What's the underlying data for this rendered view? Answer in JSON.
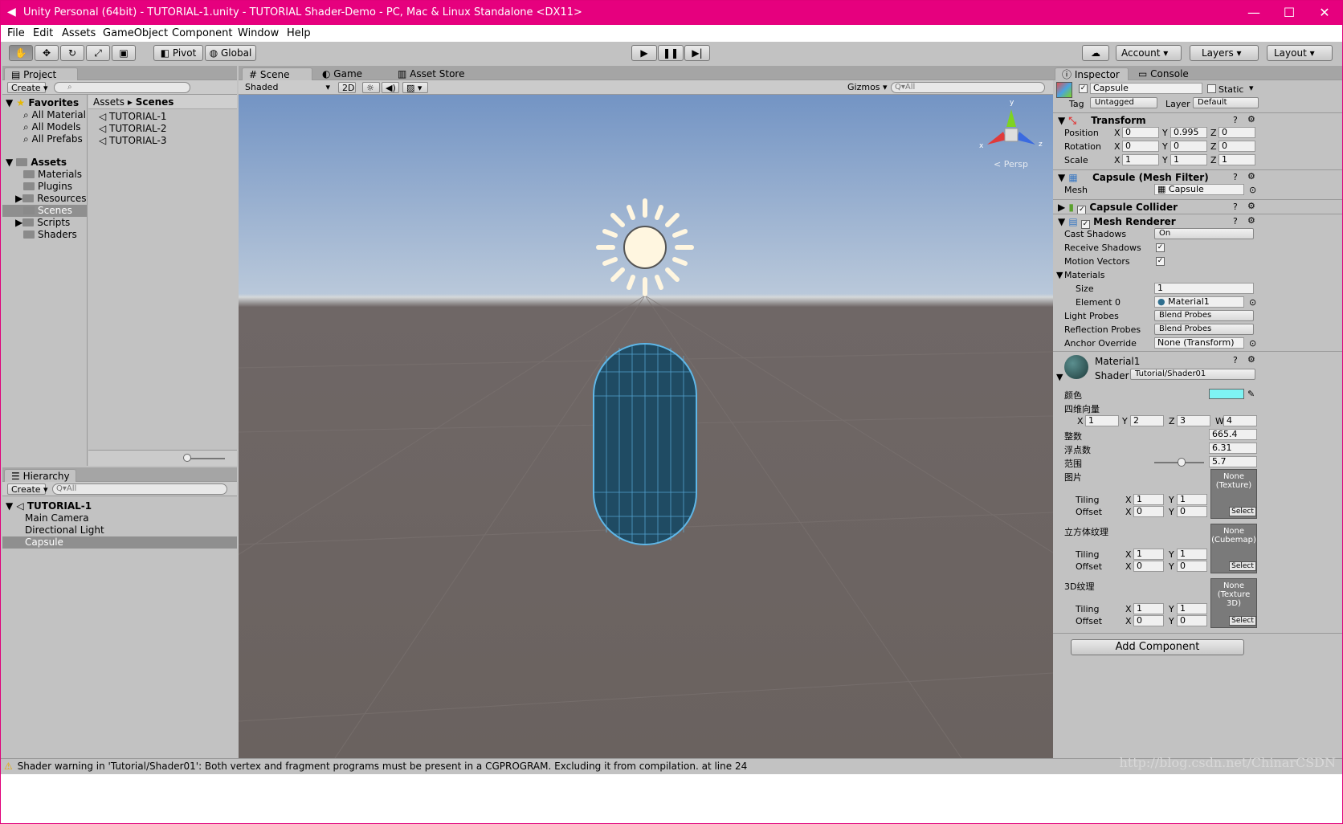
{
  "window": {
    "title": "Unity Personal (64bit) - TUTORIAL-1.unity - TUTORIAL  Shader-Demo - PC, Mac & Linux Standalone <DX11>",
    "controls": [
      "—",
      "☐",
      "✕"
    ]
  },
  "menu": [
    "File",
    "Edit",
    "Assets",
    "GameObject",
    "Component",
    "Window",
    "Help"
  ],
  "toolbar": {
    "pivot": "Pivot",
    "global": "Global",
    "account": "Account",
    "layers": "Layers",
    "layout": "Layout"
  },
  "project": {
    "tab": "Project",
    "create": "Create",
    "favorites_label": "Favorites",
    "favorites": [
      "All Material",
      "All Models",
      "All Prefabs"
    ],
    "assets_label": "Assets",
    "folders": [
      "Materials",
      "Plugins",
      "Resources",
      "Scenes",
      "Scripts",
      "Shaders"
    ],
    "breadcrumb": [
      "Assets",
      "Scenes"
    ],
    "files": [
      "TUTORIAL-1",
      "TUTORIAL-2",
      "TUTORIAL-3"
    ]
  },
  "hierarchy": {
    "tab": "Hierarchy",
    "create": "Create",
    "search_placeholder": "Q▾All",
    "scene": "TUTORIAL-1",
    "items": [
      "Main Camera",
      "Directional Light",
      "Capsule"
    ]
  },
  "scene": {
    "tabs": [
      "Scene",
      "Game",
      "Asset Store"
    ],
    "shading": "Shaded",
    "mode_2d": "2D",
    "gizmos": "Gizmos",
    "search_placeholder": "Q▾All",
    "persp": "< Persp",
    "axes": {
      "x": "x",
      "y": "y",
      "z": "z"
    }
  },
  "inspector": {
    "tabs": [
      "Inspector",
      "Console"
    ],
    "object_name": "Capsule",
    "static": "Static",
    "tag_label": "Tag",
    "tag": "Untagged",
    "layer_label": "Layer",
    "layer": "Default",
    "transform": {
      "title": "Transform",
      "position_label": "Position",
      "rotation_label": "Rotation",
      "scale_label": "Scale",
      "position": [
        "0",
        "0.995",
        "0"
      ],
      "rotation": [
        "0",
        "0",
        "0"
      ],
      "scale": [
        "1",
        "1",
        "1"
      ]
    },
    "mesh_filter": {
      "title": "Capsule (Mesh Filter)",
      "mesh_label": "Mesh",
      "mesh": "Capsule"
    },
    "collider": {
      "title": "Capsule Collider"
    },
    "renderer": {
      "title": "Mesh Renderer",
      "cast_shadows_label": "Cast Shadows",
      "cast_shadows": "On",
      "receive_shadows_label": "Receive Shadows",
      "motion_vectors_label": "Motion Vectors",
      "materials_label": "Materials",
      "size_label": "Size",
      "size": "1",
      "element0_label": "Element 0",
      "element0": "Material1",
      "light_probes_label": "Light Probes",
      "light_probes": "Blend Probes",
      "reflection_probes_label": "Reflection Probes",
      "reflection_probes": "Blend Probes",
      "anchor_label": "Anchor Override",
      "anchor": "None (Transform)"
    },
    "material": {
      "name": "Material1",
      "shader_label": "Shader",
      "shader": "Tutorial/Shader01",
      "color_label": "颜色",
      "color_value": "#7ef3f3",
      "vector_label": "四维向量",
      "vector": [
        "1",
        "2",
        "3",
        "4"
      ],
      "int_label": "整数",
      "int_value": "665.4",
      "float_label": "浮点数",
      "float_value": "6.31",
      "range_label": "范围",
      "range_value": "5.7",
      "range_fraction": 0.55,
      "image_label": "图片",
      "image_none": "None (Texture)",
      "cube_label": "立方体纹理",
      "cube_none": "None (Cubemap)",
      "tex3d_label": "3D纹理",
      "tex3d_none": "None (Texture 3D)",
      "tiling_label": "Tiling",
      "offset_label": "Offset",
      "select": "Select",
      "tiling": [
        "1",
        "1"
      ],
      "offset": [
        "0",
        "0"
      ]
    },
    "add_component": "Add Component"
  },
  "status": {
    "message": "Shader warning in 'Tutorial/Shader01': Both vertex and fragment programs must be present in a CGPROGRAM. Excluding it from compilation. at line 24",
    "watermark": "http://blog.csdn.net/ChinarCSDN"
  }
}
